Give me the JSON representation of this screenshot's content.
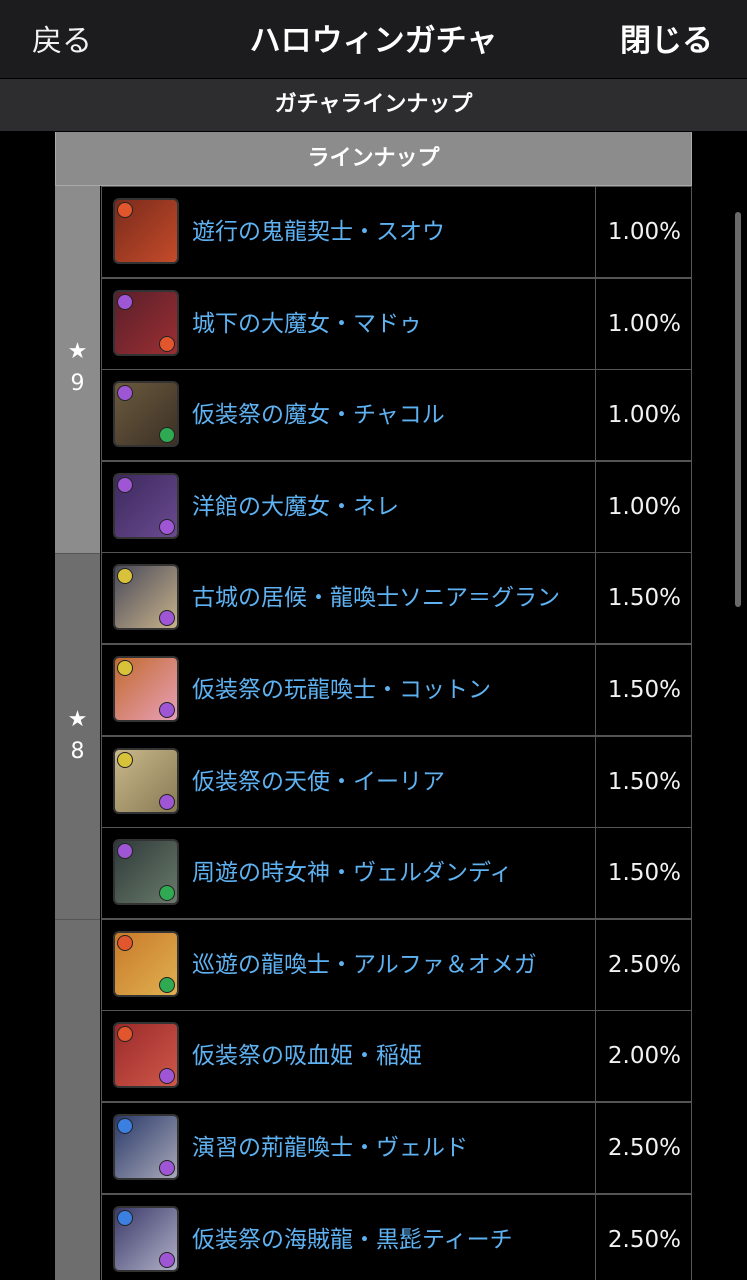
{
  "nav": {
    "back_label": "戻る",
    "title": "ハロウィンガチャ",
    "close_label": "閉じる"
  },
  "subheader": "ガチャラインナップ",
  "panel_header": "ラインナップ",
  "groups": [
    {
      "star": "★",
      "rarity": "9"
    },
    {
      "star": "★",
      "rarity": "8"
    },
    {
      "star": "",
      "rarity": ""
    }
  ],
  "rows": [
    {
      "name": "遊行の鬼龍契士・スオウ",
      "rate": "1.00%",
      "icon_colors": [
        "#7a2b1c",
        "#c44b2a"
      ],
      "attrs": [
        "#e2562d",
        ""
      ]
    },
    {
      "name": "城下の大魔女・マドゥ",
      "rate": "1.00%",
      "icon_colors": [
        "#5a1f2a",
        "#9b2f33"
      ],
      "attrs": [
        "#9f56d4",
        "#e2562d"
      ]
    },
    {
      "name": "仮装祭の魔女・チャコル",
      "rate": "1.00%",
      "icon_colors": [
        "#6b5a3e",
        "#3b3025"
      ],
      "attrs": [
        "#9f56d4",
        "#2faa52"
      ]
    },
    {
      "name": "洋館の大魔女・ネレ",
      "rate": "1.00%",
      "icon_colors": [
        "#3d2a5e",
        "#6a4a90"
      ],
      "attrs": [
        "#9f56d4",
        "#9f56d4"
      ]
    },
    {
      "name": "古城の居候・龍喚士ソニア＝グラン",
      "rate": "1.50%",
      "icon_colors": [
        "#4a4a5a",
        "#c7b28a"
      ],
      "attrs": [
        "#d8c23a",
        "#9f56d4"
      ]
    },
    {
      "name": "仮装祭の玩龍喚士・コットン",
      "rate": "1.50%",
      "icon_colors": [
        "#c26a2e",
        "#e8a0b8"
      ],
      "attrs": [
        "#d8c23a",
        "#9f56d4"
      ]
    },
    {
      "name": "仮装祭の天使・イーリア",
      "rate": "1.50%",
      "icon_colors": [
        "#c8b88a",
        "#8a7a55"
      ],
      "attrs": [
        "#d8c23a",
        "#9f56d4"
      ]
    },
    {
      "name": "周遊の時女神・ヴェルダンディ",
      "rate": "1.50%",
      "icon_colors": [
        "#2e3a3a",
        "#6a7a6a"
      ],
      "attrs": [
        "#9f56d4",
        "#2faa52"
      ]
    },
    {
      "name": "巡遊の龍喚士・アルファ＆オメガ",
      "rate": "2.50%",
      "icon_colors": [
        "#c97a2a",
        "#e0b050"
      ],
      "attrs": [
        "#e2562d",
        "#2faa52"
      ]
    },
    {
      "name": "仮装祭の吸血姫・稲姫",
      "rate": "2.00%",
      "icon_colors": [
        "#9a2a2a",
        "#d0584a"
      ],
      "attrs": [
        "#e2562d",
        "#9f56d4"
      ]
    },
    {
      "name": "演習の荊龍喚士・ヴェルド",
      "rate": "2.50%",
      "icon_colors": [
        "#2a3a6a",
        "#a8a8b8"
      ],
      "attrs": [
        "#3b7fe0",
        "#9f56d4"
      ]
    },
    {
      "name": "仮装祭の海賊龍・黒髭ティーチ",
      "rate": "2.50%",
      "icon_colors": [
        "#3a3a6a",
        "#b0b0c8"
      ],
      "attrs": [
        "#3b7fe0",
        "#9f56d4"
      ]
    }
  ]
}
